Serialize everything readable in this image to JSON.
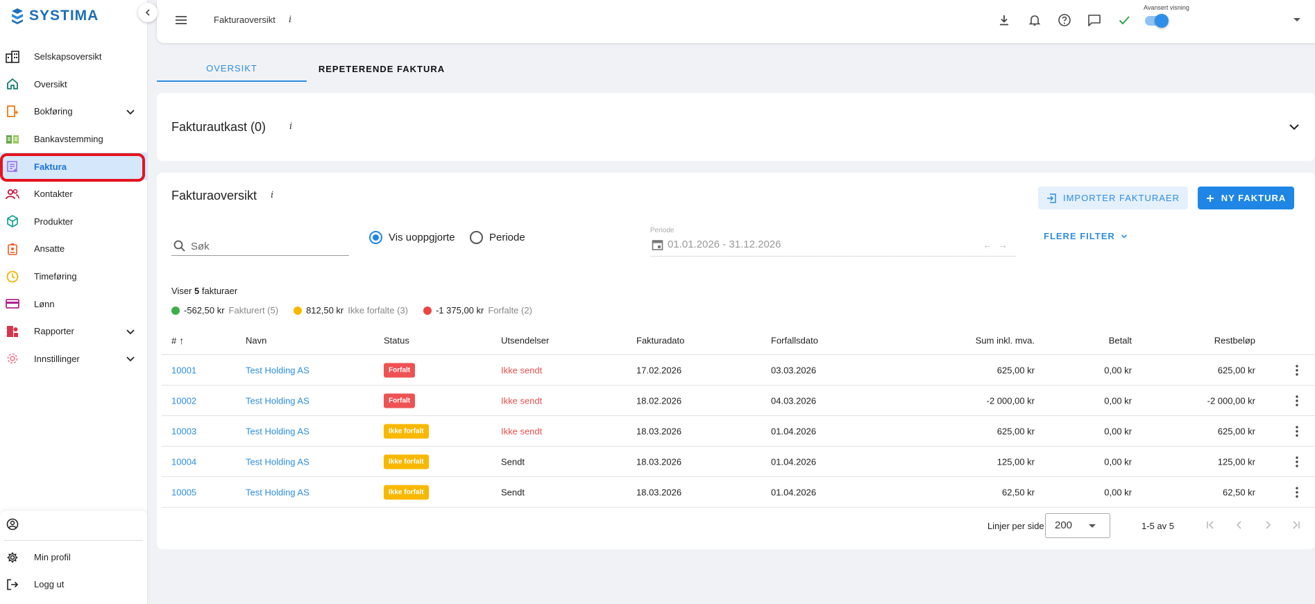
{
  "app": {
    "logo_text": "SYSTIMA"
  },
  "sidebar": {
    "items": [
      {
        "label": "Selskapsoversikt",
        "icon": "building-icon"
      },
      {
        "label": "Oversikt",
        "icon": "home-icon"
      },
      {
        "label": "Bokføring",
        "icon": "ledger-icon",
        "expandable": true
      },
      {
        "label": "Bankavstemming",
        "icon": "bank-reconcile-icon"
      },
      {
        "label": "Faktura",
        "icon": "invoice-icon",
        "active": true
      },
      {
        "label": "Kontakter",
        "icon": "contacts-icon"
      },
      {
        "label": "Produkter",
        "icon": "box-icon"
      },
      {
        "label": "Ansatte",
        "icon": "employee-badge-icon"
      },
      {
        "label": "Timeføring",
        "icon": "clock-icon"
      },
      {
        "label": "Lønn",
        "icon": "card-icon"
      },
      {
        "label": "Rapporter",
        "icon": "reports-icon",
        "expandable": true
      },
      {
        "label": "Innstillinger",
        "icon": "settings-gear-icon",
        "expandable": true
      }
    ],
    "bottom": {
      "profile_label": "Min profil",
      "logout_label": "Logg ut"
    }
  },
  "topbar": {
    "title": "Fakturaoversikt",
    "info": "i",
    "advanced_label": "Avansert visning",
    "advanced_on": true
  },
  "tabs": [
    {
      "label": "OVERSIKT",
      "active": true
    },
    {
      "label": "REPETERENDE FAKTURA",
      "active": false
    }
  ],
  "drafts": {
    "title": "Fakturautkast (0)",
    "info": "i"
  },
  "overview": {
    "title": "Fakturaoversikt",
    "info": "i",
    "import_label": "IMPORTER FAKTURAER",
    "new_label": "NY FAKTURA",
    "search_placeholder": "Søk",
    "radio_unsettled": "Vis uoppgjorte",
    "radio_period": "Periode",
    "period_label": "Periode",
    "period_value": "01.01.2026 - 31.12.2026",
    "more_filter": "FLERE FILTER",
    "showing_prefix": "Viser",
    "showing_count": "5",
    "showing_suffix": "fakturaer",
    "legend": [
      {
        "amount": "-562,50 kr",
        "label": "Fakturert (5)",
        "color": "#3fae4a"
      },
      {
        "amount": "812,50 kr",
        "label": "Ikke forfalte (3)",
        "color": "#f8b800"
      },
      {
        "amount": "-1 375,00 kr",
        "label": "Forfalte (2)",
        "color": "#ee4444"
      }
    ]
  },
  "table": {
    "headers": {
      "num": "#",
      "name": "Navn",
      "status": "Status",
      "send": "Utsendelser",
      "fdate": "Fakturadato",
      "due": "Forfallsdato",
      "sum": "Sum inkl. mva.",
      "paid": "Betalt",
      "rest": "Restbeløp"
    },
    "rows": [
      {
        "num": "10001",
        "name": "Test Holding AS",
        "status": "Forfalt",
        "status_type": "forfalt",
        "send": "Ikke sendt",
        "send_red": true,
        "fdate": "17.02.2026",
        "due": "03.03.2026",
        "sum": "625,00 kr",
        "paid": "0,00 kr",
        "rest": "625,00 kr"
      },
      {
        "num": "10002",
        "name": "Test Holding AS",
        "status": "Forfalt",
        "status_type": "forfalt",
        "send": "Ikke sendt",
        "send_red": true,
        "fdate": "18.02.2026",
        "due": "04.03.2026",
        "sum": "-2 000,00 kr",
        "paid": "0,00 kr",
        "rest": "-2 000,00 kr"
      },
      {
        "num": "10003",
        "name": "Test Holding AS",
        "status": "Ikke forfalt",
        "status_type": "ikke",
        "send": "Ikke sendt",
        "send_red": true,
        "fdate": "18.03.2026",
        "due": "01.04.2026",
        "sum": "625,00 kr",
        "paid": "0,00 kr",
        "rest": "625,00 kr"
      },
      {
        "num": "10004",
        "name": "Test Holding AS",
        "status": "Ikke forfalt",
        "status_type": "ikke",
        "send": "Sendt",
        "send_red": false,
        "fdate": "18.03.2026",
        "due": "01.04.2026",
        "sum": "125,00 kr",
        "paid": "0,00 kr",
        "rest": "125,00 kr"
      },
      {
        "num": "10005",
        "name": "Test Holding AS",
        "status": "Ikke forfalt",
        "status_type": "ikke",
        "send": "Sendt",
        "send_red": false,
        "fdate": "18.03.2026",
        "due": "01.04.2026",
        "sum": "62,50 kr",
        "paid": "0,00 kr",
        "rest": "62,50 kr"
      }
    ]
  },
  "pagination": {
    "rows_per_page_label": "Linjer per side",
    "rows_per_page": "200",
    "range": "1-5 av 5"
  }
}
